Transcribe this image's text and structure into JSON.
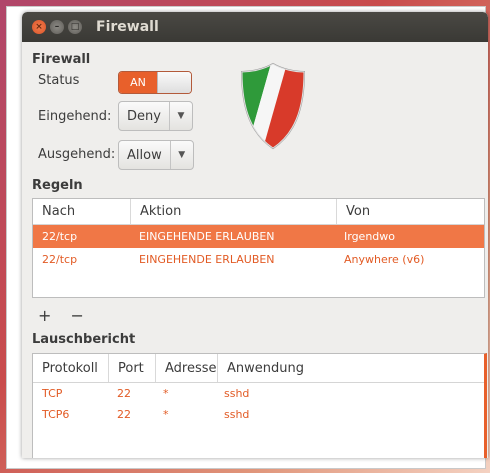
{
  "window": {
    "title": "Firewall"
  },
  "firewall": {
    "heading": "Firewall",
    "status_label": "Status",
    "status_value": "AN",
    "incoming_label": "Eingehend:",
    "incoming_value": "Deny",
    "outgoing_label": "Ausgehend:",
    "outgoing_value": "Allow"
  },
  "rules": {
    "heading": "Regeln",
    "columns": [
      "Nach",
      "Aktion",
      "Von"
    ],
    "rows": [
      {
        "to": "22/tcp",
        "action": "EINGEHENDE ERLAUBEN",
        "from": "Irgendwo",
        "selected": true
      },
      {
        "to": "22/tcp",
        "action": "EINGEHENDE ERLAUBEN",
        "from": "Anywhere (v6)",
        "selected": false
      }
    ],
    "add_label": "+",
    "remove_label": "−"
  },
  "listening": {
    "heading": "Lauschbericht",
    "columns": [
      "Protokoll",
      "Port",
      "Adresse",
      "Anwendung"
    ],
    "rows": [
      {
        "protocol": "TCP",
        "port": "22",
        "address": "*",
        "app": "sshd"
      },
      {
        "protocol": "TCP6",
        "port": "22",
        "address": "*",
        "app": "sshd"
      }
    ]
  },
  "colors": {
    "accent": "#e8602b",
    "selection": "#f07746",
    "titlebar": "#3c3b37"
  }
}
